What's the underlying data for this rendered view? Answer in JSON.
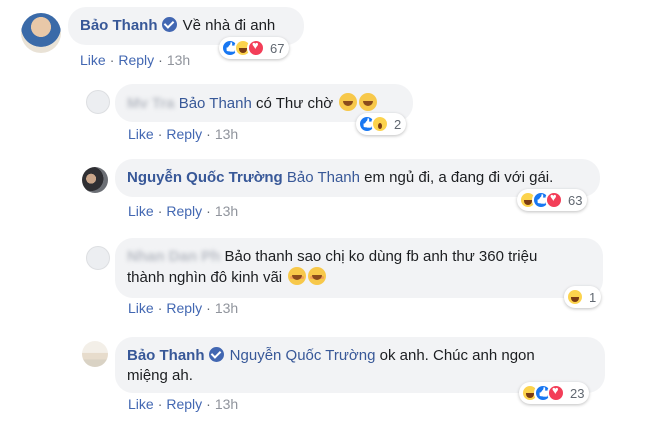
{
  "actions": {
    "like": "Like",
    "reply": "Reply",
    "dot": "·"
  },
  "comments": [
    {
      "author": "Bảo Thanh",
      "verified": true,
      "mention": "",
      "text": "Về nhà đi anh",
      "time": "13h",
      "reactions": [
        "like",
        "haha",
        "love"
      ],
      "reaction_count": "67"
    },
    {
      "author": "Mv Tra",
      "author_blurred": true,
      "mention": "Bảo Thanh",
      "text": "có Thư chờ",
      "emoji_count": 2,
      "time": "13h",
      "reactions": [
        "like",
        "wow"
      ],
      "reaction_count": "2"
    },
    {
      "author": "Nguyễn Quốc Trường",
      "mention": "Bảo Thanh",
      "text": "em ngủ đi, a đang đi với gái.",
      "time": "13h",
      "reactions": [
        "haha",
        "like",
        "love"
      ],
      "reaction_count": "63"
    },
    {
      "author": "Nhan Dan Ph",
      "author_blurred": true,
      "mention": "",
      "text_line1": "Bảo thanh sao chị ko dùng fb anh thư 360 triệu",
      "text_line2": "thành nghìn đô kinh vãi",
      "emoji_count": 2,
      "time": "13h",
      "reactions": [
        "haha"
      ],
      "reaction_count": "1"
    },
    {
      "author": "Bảo Thanh",
      "verified": true,
      "mention": "Nguyễn Quốc Trường",
      "text_line1": "ok anh. Chúc anh ngon",
      "text_line2": "miệng ah.",
      "time": "13h",
      "reactions": [
        "haha",
        "like",
        "love"
      ],
      "reaction_count": "23"
    }
  ],
  "colors": {
    "link": "#385898",
    "action": "#4267b2",
    "bubble": "#f2f3f5",
    "like": "#1877f2",
    "love": "#f33e58",
    "haha": "#fcd34d"
  }
}
